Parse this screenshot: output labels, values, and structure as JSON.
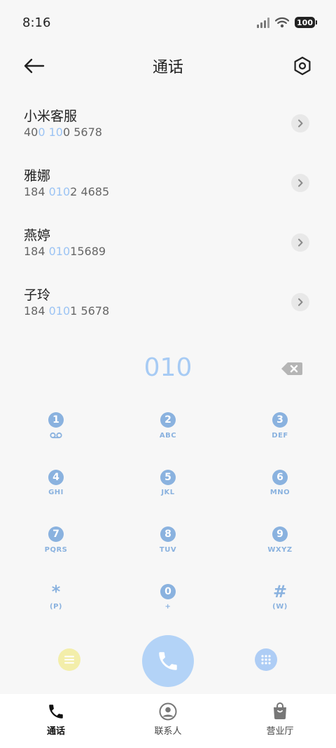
{
  "status_bar": {
    "time": "8:16",
    "battery": "100"
  },
  "header": {
    "title": "通话"
  },
  "results": [
    {
      "name": "小米客服",
      "number_parts": [
        [
          "40",
          false
        ],
        [
          "0 10",
          true
        ],
        [
          "0 5678",
          false
        ]
      ]
    },
    {
      "name": "雅娜",
      "number_parts": [
        [
          "184 ",
          false
        ],
        [
          "010",
          true
        ],
        [
          "2 4685",
          false
        ]
      ]
    },
    {
      "name": "燕婷",
      "number_parts": [
        [
          "184 ",
          false
        ],
        [
          "010",
          true
        ],
        [
          "15689",
          false
        ]
      ]
    },
    {
      "name": "子玲",
      "number_parts": [
        [
          "184 ",
          false
        ],
        [
          "010",
          true
        ],
        [
          "1 5678",
          false
        ]
      ]
    }
  ],
  "dialer": {
    "input": "010",
    "keys": [
      {
        "digit": "1",
        "letters": ""
      },
      {
        "digit": "2",
        "letters": "ABC"
      },
      {
        "digit": "3",
        "letters": "DEF"
      },
      {
        "digit": "4",
        "letters": "GHI"
      },
      {
        "digit": "5",
        "letters": "JKL"
      },
      {
        "digit": "6",
        "letters": "MNO"
      },
      {
        "digit": "7",
        "letters": "PQRS"
      },
      {
        "digit": "8",
        "letters": "TUV"
      },
      {
        "digit": "9",
        "letters": "WXYZ"
      },
      {
        "digit": "*",
        "letters": "(P)"
      },
      {
        "digit": "0",
        "letters": "+"
      },
      {
        "digit": "#",
        "letters": "(W)"
      }
    ]
  },
  "bottom_nav": [
    {
      "label": "通话",
      "icon": "phone-icon",
      "active": true
    },
    {
      "label": "联系人",
      "icon": "contact-icon",
      "active": false
    },
    {
      "label": "营业厅",
      "icon": "shopping-bag-icon",
      "active": false
    }
  ],
  "colors": {
    "accent": "#8ab2df",
    "highlight": "#9cc4f4",
    "call": "#b3d3f7",
    "menu": "#f3eeaa"
  }
}
